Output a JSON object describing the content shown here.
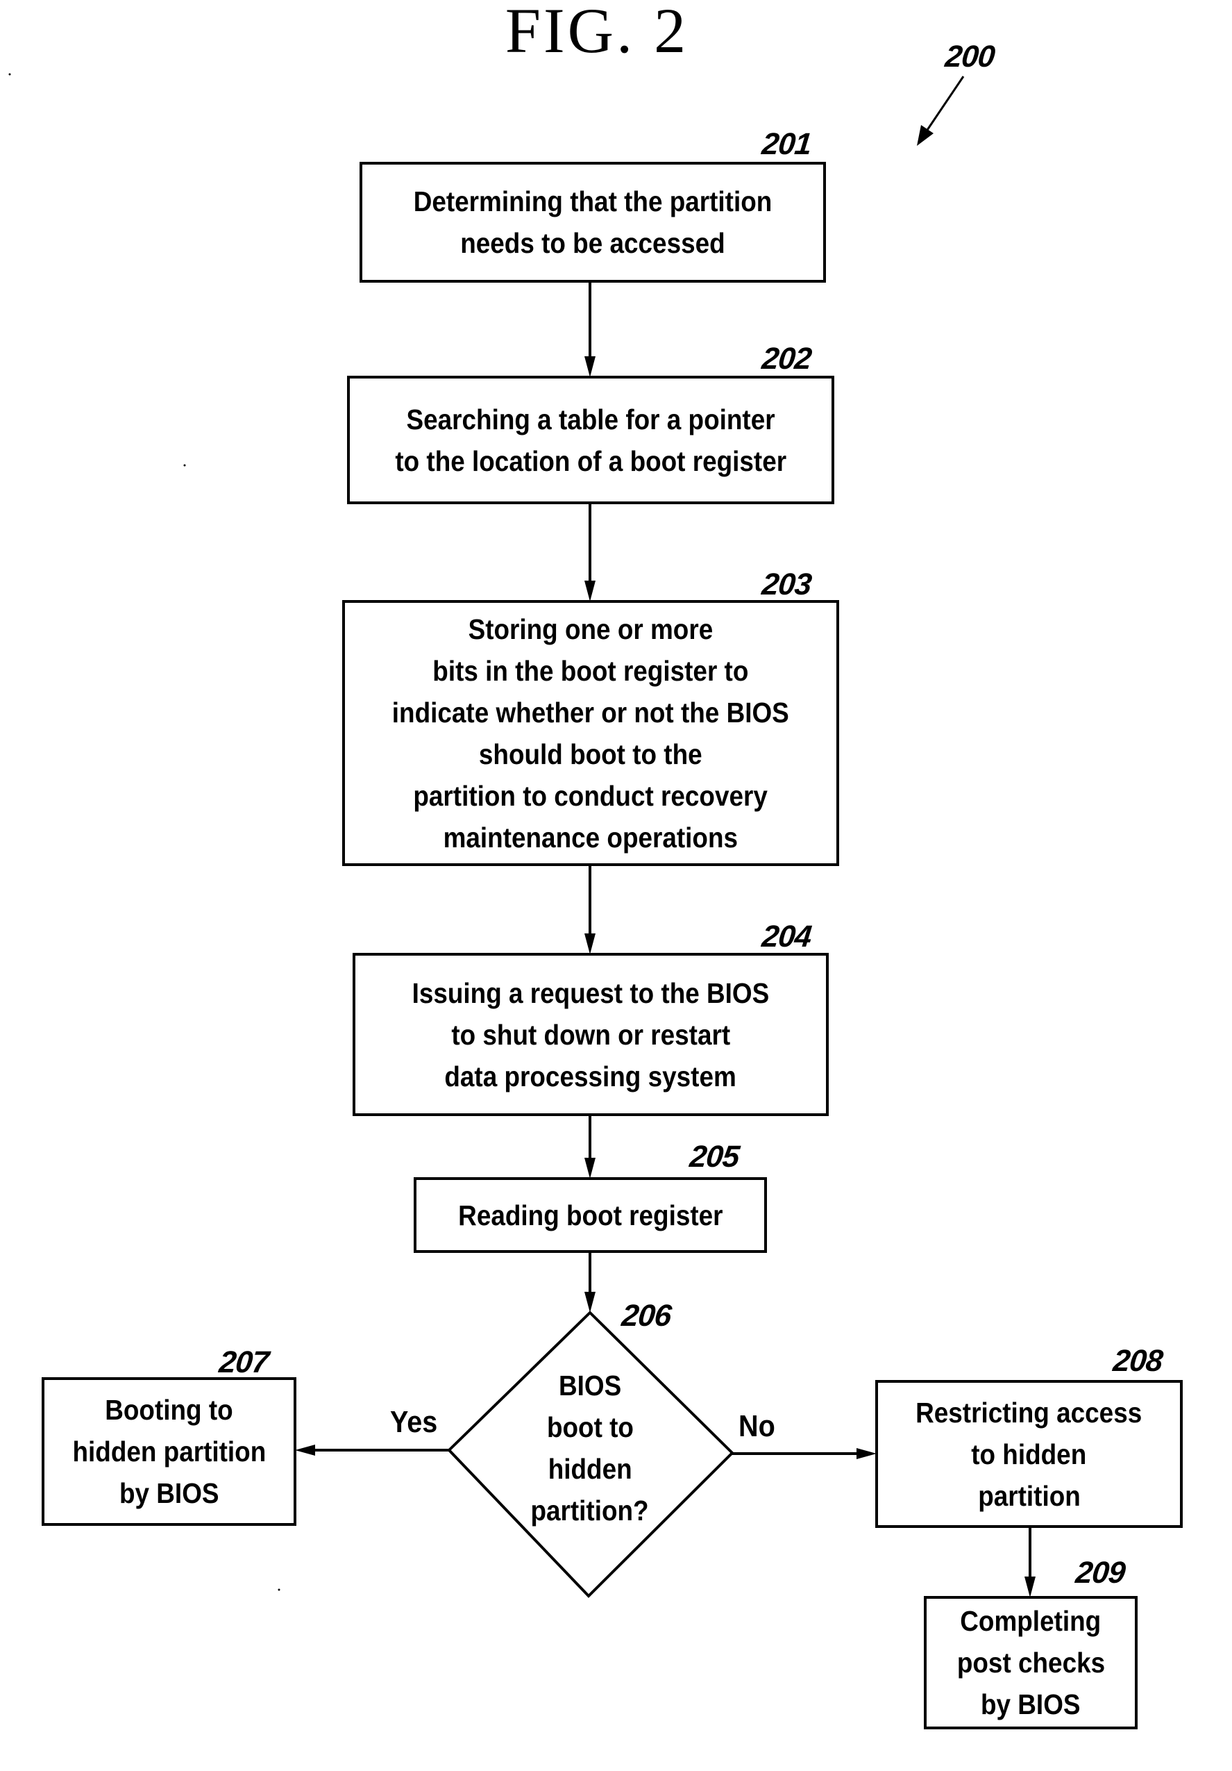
{
  "figure": {
    "title": "FIG. 2",
    "reference": "200"
  },
  "steps": [
    {
      "id": "201",
      "shape": "process",
      "lines": [
        "Determining that the partition",
        "needs to be accessed"
      ]
    },
    {
      "id": "202",
      "shape": "process",
      "lines": [
        "Searching a table for a pointer",
        "to the location of a boot register"
      ]
    },
    {
      "id": "203",
      "shape": "process",
      "lines": [
        "Storing one or more",
        "bits in the boot register to",
        "indicate whether or not the BIOS",
        "should boot to the",
        "partition to conduct recovery",
        "maintenance operations"
      ]
    },
    {
      "id": "204",
      "shape": "process",
      "lines": [
        "Issuing a request to the BIOS",
        "to shut down or restart",
        "data processing system"
      ]
    },
    {
      "id": "205",
      "shape": "process",
      "lines": [
        "Reading boot register"
      ]
    },
    {
      "id": "206",
      "shape": "decision",
      "lines": [
        "BIOS",
        "boot to",
        "hidden",
        "partition?"
      ]
    },
    {
      "id": "207",
      "shape": "process",
      "lines": [
        "Booting to",
        "hidden partition",
        "by BIOS"
      ]
    },
    {
      "id": "208",
      "shape": "process",
      "lines": [
        "Restricting access",
        "to hidden",
        "partition"
      ]
    },
    {
      "id": "209",
      "shape": "process",
      "lines": [
        "Completing",
        "post checks",
        "by BIOS"
      ]
    }
  ],
  "edges": [
    {
      "from": "201",
      "to": "202",
      "label": ""
    },
    {
      "from": "202",
      "to": "203",
      "label": ""
    },
    {
      "from": "203",
      "to": "204",
      "label": ""
    },
    {
      "from": "204",
      "to": "205",
      "label": ""
    },
    {
      "from": "205",
      "to": "206",
      "label": ""
    },
    {
      "from": "206",
      "to": "207",
      "label": "Yes"
    },
    {
      "from": "206",
      "to": "208",
      "label": "No"
    },
    {
      "from": "208",
      "to": "209",
      "label": ""
    }
  ]
}
